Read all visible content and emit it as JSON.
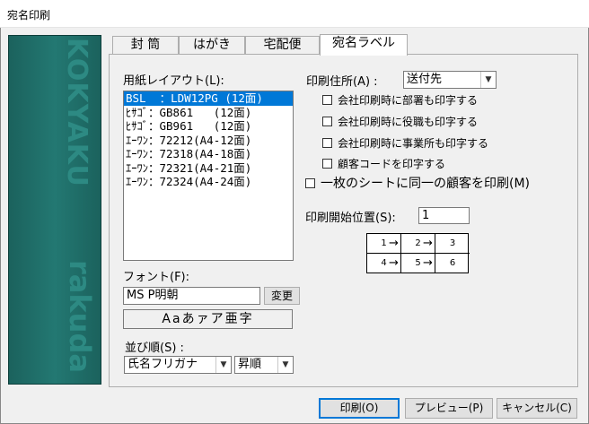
{
  "window": {
    "title": "宛名印刷"
  },
  "sidebar": {
    "brand_top": "KOKYAKU",
    "brand_bottom": "rakuda"
  },
  "tabs": [
    {
      "label": "封 筒"
    },
    {
      "label": "はがき"
    },
    {
      "label": "宅配便"
    },
    {
      "label": "宛名ラベル",
      "active": true
    }
  ],
  "layout": {
    "label": "用紙レイアウト(L):",
    "items": [
      "BSL  ：LDW12PG (12面)",
      "ﾋｻｺﾞ：GB861   (12面)",
      "ﾋｻｺﾞ：GB961   (12面)",
      "ｴｰﾜﾝ：72212(A4-12面)",
      "ｴｰﾜﾝ：72318(A4-18面)",
      "ｴｰﾜﾝ：72321(A4-21面)",
      "ｴｰﾜﾝ：72324(A4-24面)"
    ],
    "selected_index": 0
  },
  "font": {
    "label": "フォント(F):",
    "value": "MS P明朝",
    "change_button": "変更",
    "sample": "Aaあァア亜字"
  },
  "sort": {
    "label": "並び順(S) :",
    "field_value": "氏名フリガナ",
    "order_value": "昇順"
  },
  "address": {
    "label": "印刷住所(A) :",
    "value": "送付先",
    "options": [
      {
        "label": "会社印刷時に部署も印字する",
        "checked": false
      },
      {
        "label": "会社印刷時に役職も印字する",
        "checked": false
      },
      {
        "label": "会社印刷時に事業所も印字する",
        "checked": false
      },
      {
        "label": "顧客コードを印字する",
        "checked": false
      }
    ]
  },
  "same_customer": {
    "label": "一枚のシートに同一の顧客を印刷(M)",
    "checked": false
  },
  "start_position": {
    "label": "印刷開始位置(S):",
    "value": "1",
    "grid": [
      "1",
      "2",
      "3",
      "4",
      "5",
      "6"
    ]
  },
  "footer": {
    "print": "印刷(O)",
    "preview": "プレビュー(P)",
    "cancel": "キャンセル(C)"
  }
}
